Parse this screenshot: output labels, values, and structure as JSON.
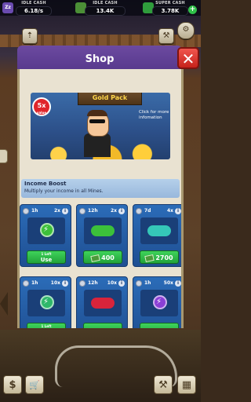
{
  "topbar": {
    "idle_cash_label_1": "IDLE CASH",
    "idle_cash_value_1": "6.18/s",
    "idle_cash_label_2": "IDLE CASH",
    "idle_cash_value_2": "13.4K",
    "super_cash_label": "SUPER CASH",
    "super_cash_value": "3.78K",
    "add_symbol": "+",
    "sleep_icon_text": "Zz"
  },
  "shop": {
    "title": "Shop",
    "close_symbol": "✕"
  },
  "pack": {
    "title": "Gold Pack",
    "badge_value": "5x",
    "badge_sub": "value",
    "info_text": "Click for more infomation"
  },
  "boost": {
    "title": "Income Boost",
    "subtitle": "Multiply your income in all Mines."
  },
  "cards": [
    {
      "duration": "1h",
      "multiplier": "2x",
      "button_top": "1 Left",
      "button_label": "Use",
      "gem_color": "#3cc13a"
    },
    {
      "duration": "12h",
      "multiplier": "2x",
      "button_label": "400",
      "gem_color": "#3cc13a"
    },
    {
      "duration": "7d",
      "multiplier": "4x",
      "button_label": "2700",
      "gem_color": "#35c7b8"
    },
    {
      "duration": "1h",
      "multiplier": "10x",
      "button_top": "1 Left",
      "gem_color": "#2fb86a"
    },
    {
      "duration": "12h",
      "multiplier": "10x",
      "gem_color": "#d8243b"
    },
    {
      "duration": "1h",
      "multiplier": "50x",
      "gem_color": "#8b3fd6"
    }
  ],
  "bottom": {
    "cash_icon": "$",
    "cart_icon": "🛒",
    "hammer_icon": "⚒",
    "map_icon": "▦"
  },
  "info_symbol": "i",
  "colors": {
    "accent_purple": "#5f3f96",
    "close_red": "#d9342b",
    "button_green": "#2fbf49",
    "card_blue": "#2460a8"
  }
}
